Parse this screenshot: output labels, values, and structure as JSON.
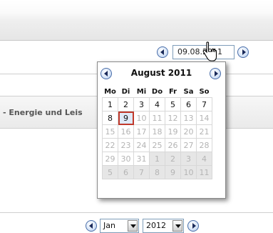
{
  "date_field": {
    "value": "09.08.2011"
  },
  "calendar": {
    "title": "August 2011",
    "weekdays": [
      "Mo",
      "Di",
      "Mi",
      "Do",
      "Fr",
      "Sa",
      "So"
    ],
    "weeks": [
      [
        "1",
        "2",
        "3",
        "4",
        "5",
        "6",
        "7"
      ],
      [
        "8",
        "9",
        "10",
        "11",
        "12",
        "13",
        "14"
      ],
      [
        "15",
        "16",
        "17",
        "18",
        "19",
        "20",
        "21"
      ],
      [
        "22",
        "23",
        "24",
        "25",
        "26",
        "27",
        "28"
      ],
      [
        "29",
        "30",
        "31",
        "1",
        "2",
        "3",
        "4"
      ],
      [
        "5",
        "6",
        "7",
        "8",
        "9",
        "10",
        "11"
      ]
    ],
    "selected_day": "9"
  },
  "section": {
    "label": "- Energie und Leis"
  },
  "month_select": {
    "value": "Jan"
  },
  "year_select": {
    "value": "2012"
  },
  "icons": {
    "prev": "arrow-left-icon",
    "next": "arrow-right-icon",
    "cursor": "hand-cursor-icon",
    "dropdown": "dropdown-arrow-icon"
  },
  "colors": {
    "selected_border": "#c0392b",
    "button_border": "#4a6ea9"
  }
}
